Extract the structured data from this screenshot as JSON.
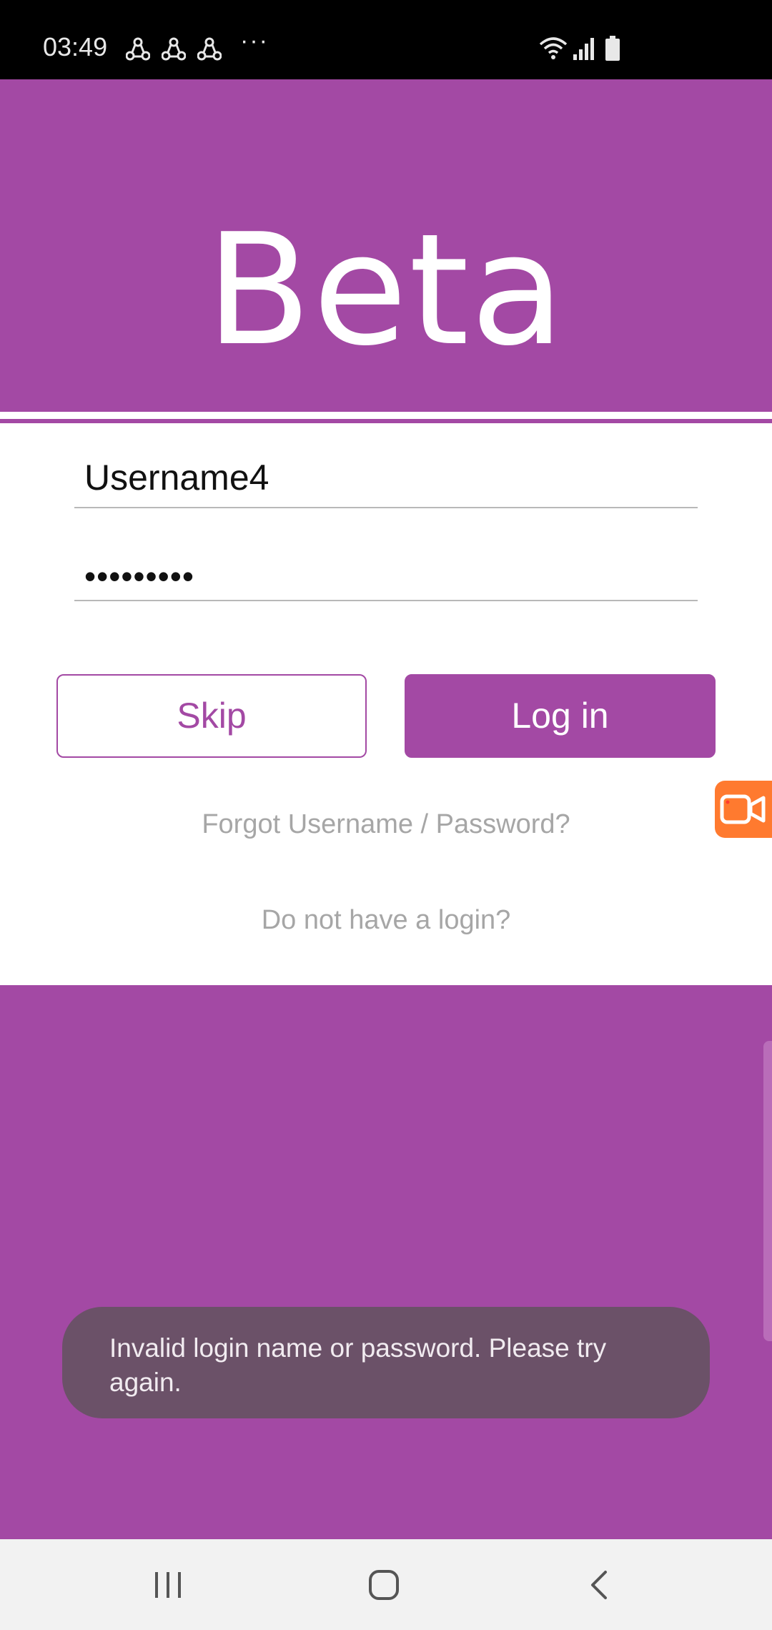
{
  "status_bar": {
    "time": "03:49",
    "more_indicator": "···",
    "icons": [
      "share-icon",
      "share-icon",
      "share-icon",
      "wifi-icon",
      "signal-icon",
      "battery-icon"
    ]
  },
  "header": {
    "title": "Beta"
  },
  "login_form": {
    "username_value": "Username4",
    "password_value": "•••••••••",
    "skip_label": "Skip",
    "login_label": "Log in",
    "forgot_link": "Forgot Username / Password?",
    "register_link": "Do not have a login?"
  },
  "toast": {
    "message": "Invalid login name or password. Please try again."
  },
  "colors": {
    "accent": "#a349a4",
    "toast_background": "#6b5168",
    "link_gray": "#a6a6a6",
    "recorder_orange": "#ff7a2f"
  },
  "navigation_bar": {
    "icons": [
      "recent-apps-icon",
      "home-icon",
      "back-icon"
    ]
  }
}
